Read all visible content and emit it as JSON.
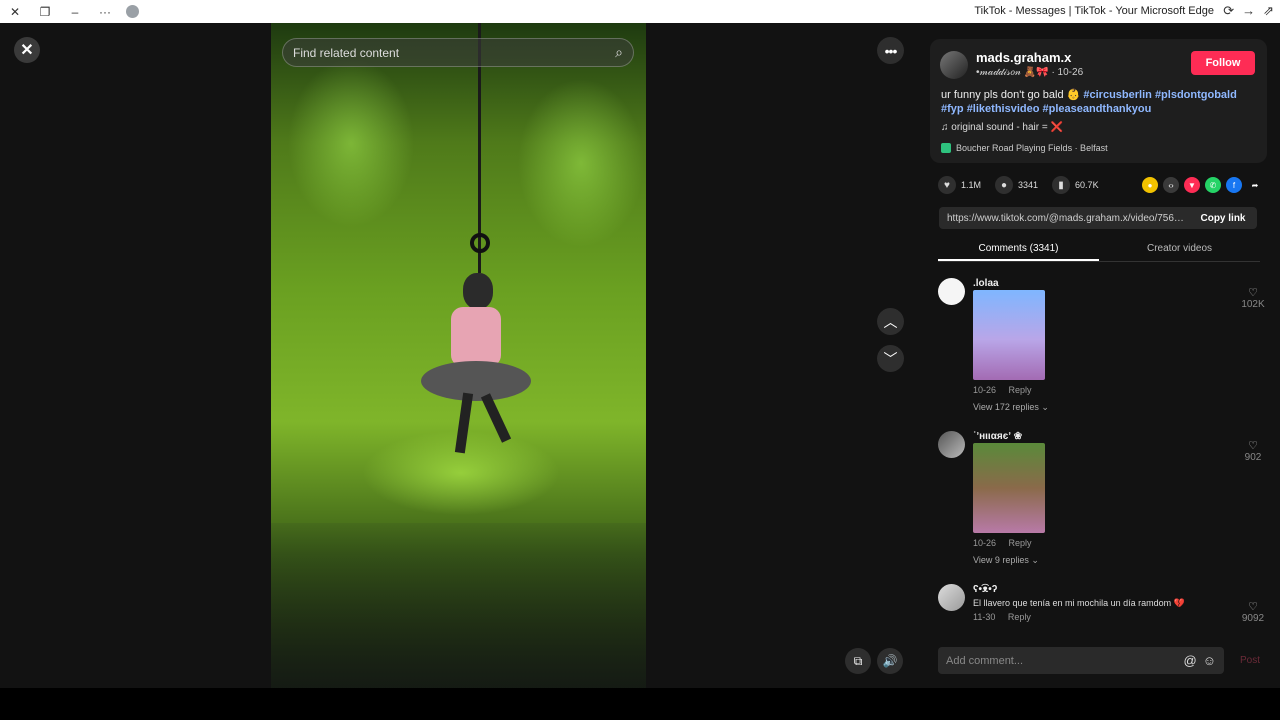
{
  "browser": {
    "title": "TikTok - Messages | TikTok - Your Microsoft Edge",
    "icons": [
      "close-icon",
      "restore-icon",
      "minimize-icon",
      "more-icon",
      "profile-icon",
      "refresh-icon",
      "forward-icon",
      "share-icon"
    ]
  },
  "video": {
    "search_placeholder": "Find related content",
    "close_symbol": "✕",
    "more_symbol": "•••",
    "up_symbol": "︿",
    "down_symbol": "﹀",
    "volume_symbol": "🔊",
    "pip_symbol": "⧉"
  },
  "post": {
    "author": "mads.graham.x",
    "subline": "•𝓂𝒶𝒹𝒹𝒾𝓈𝑜𝓃 🧸🎀 · 10-26",
    "follow_label": "Follow",
    "caption_text": "ur funny pls don't go bald 👶 ",
    "hashtags": [
      "#circusberlin",
      "#plsdontgobald",
      "#fyp",
      "#likethisvideo",
      "#pleaseandthankyou"
    ],
    "sound": "♫  original sound - hair = ❌",
    "location": "Boucher Road Playing Fields · Belfast"
  },
  "actions": {
    "likes": "1.1M",
    "comments": "3341",
    "saves": "60.7K"
  },
  "share": {
    "url": "https://www.tiktok.com/@mads.graham.x/video/75652...",
    "copy_label": "Copy link"
  },
  "tabs": {
    "comments": "Comments (3341)",
    "creator": "Creator videos"
  },
  "comments": [
    {
      "name": ".lolaa",
      "date": "10-26",
      "reply": "Reply",
      "replies": "View 172 replies ⌄",
      "likes": "102K"
    },
    {
      "name": "˙ʼнιιαяєʼ ❀",
      "date": "10-26",
      "reply": "Reply",
      "replies": "View 9 replies ⌄",
      "likes": "902"
    },
    {
      "name": "ʕ•͡ᴥ•ʔ",
      "text": "El llavero que tenía en mi mochila un día ramdom 💔",
      "date": "11-30",
      "reply": "Reply",
      "likes": "9092"
    }
  ],
  "input": {
    "placeholder": "Add comment...",
    "post_label": "Post"
  },
  "colors": {
    "follow": "#fe2c55",
    "hashtag": "#8fb8ff"
  }
}
